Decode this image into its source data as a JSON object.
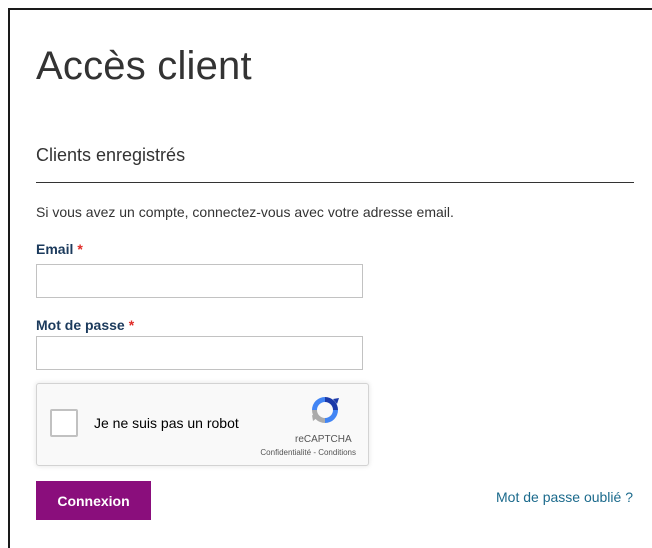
{
  "page": {
    "title": "Accès client"
  },
  "login": {
    "section_title": "Clients enregistrés",
    "intro": "Si vous avez un compte, connectez-vous avec votre adresse email.",
    "email_label": "Email",
    "password_label": "Mot de passe",
    "required_marker": "*",
    "email_value": "",
    "password_value": "",
    "submit_label": "Connexion",
    "forgot_label": "Mot de passe oublié ?"
  },
  "recaptcha": {
    "label": "Je ne suis pas un robot",
    "brand": "reCAPTCHA",
    "terms": "Confidentialité - Conditions",
    "checked": false,
    "logo_icon": "recaptcha-logo-icon"
  },
  "colors": {
    "accent_button": "#8a0e7c",
    "label": "#1b3a5c",
    "required": "#e02b27",
    "link": "#1b6a8c"
  }
}
